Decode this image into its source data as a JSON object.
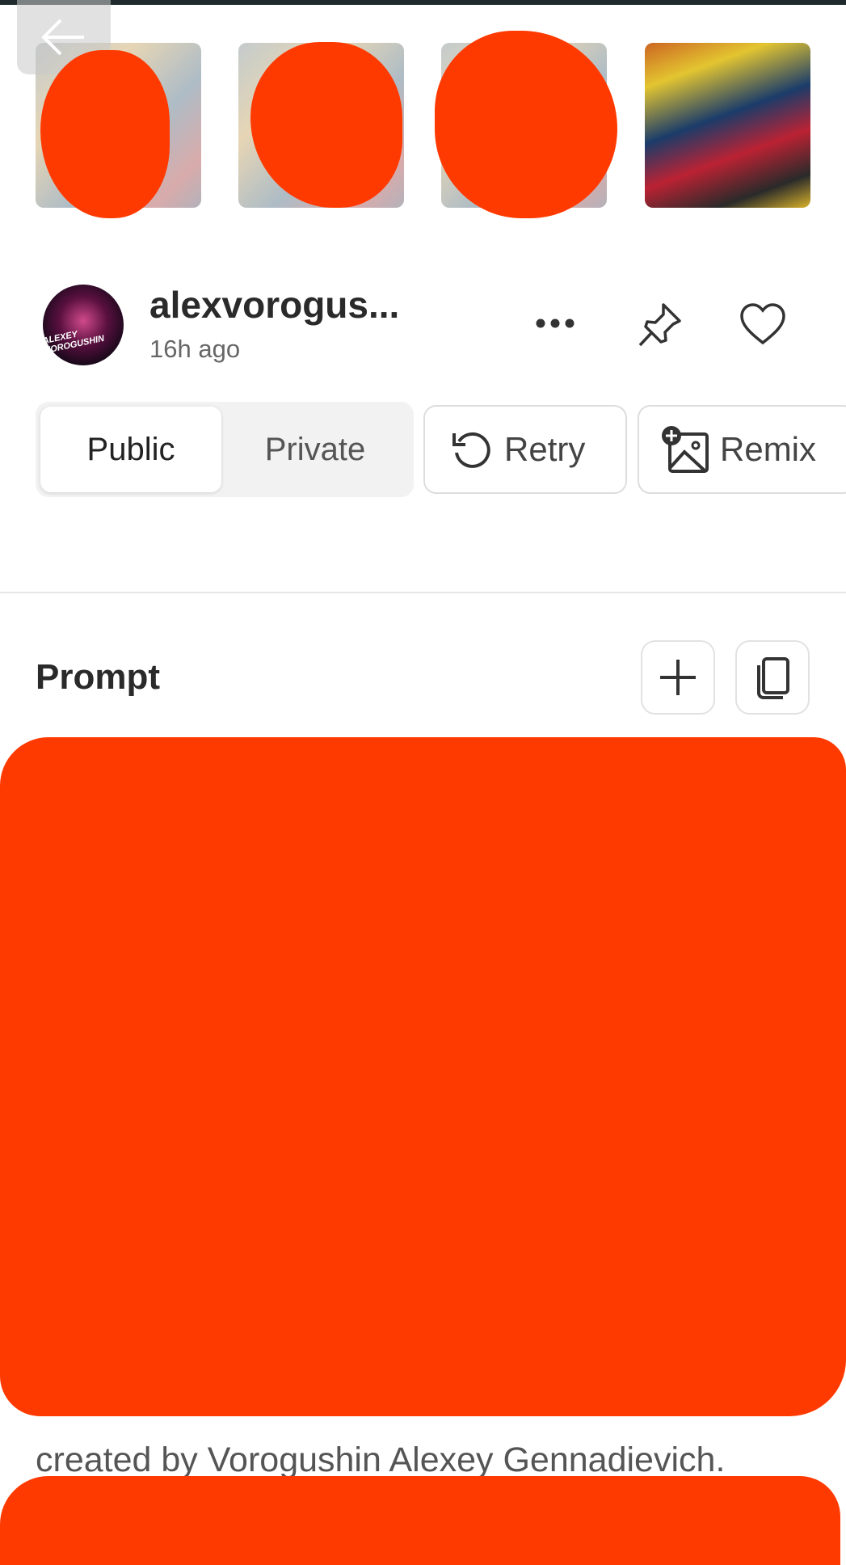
{
  "header": {
    "back_icon": "arrow-left-icon"
  },
  "thumbnails": [
    {
      "selected": false
    },
    {
      "selected": false
    },
    {
      "selected": false
    },
    {
      "selected": true
    }
  ],
  "author": {
    "username": "alexvorogus...",
    "time": "16h ago",
    "avatar_text": "ALEXEY VOROGUSHIN"
  },
  "actions": {
    "more_icon": "ellipsis-icon",
    "pin_icon": "pin-icon",
    "like_icon": "heart-icon"
  },
  "visibility": {
    "options": [
      "Public",
      "Private"
    ],
    "selected": "Public"
  },
  "buttons": {
    "retry": "Retry",
    "remix": "Remix"
  },
  "prompt": {
    "label": "Prompt",
    "add_icon": "plus-icon",
    "copy_icon": "copy-icon",
    "visible_text": "created by Vorogushin Alexey Gennadievich."
  },
  "colors": {
    "redaction": "#FF3A00"
  }
}
